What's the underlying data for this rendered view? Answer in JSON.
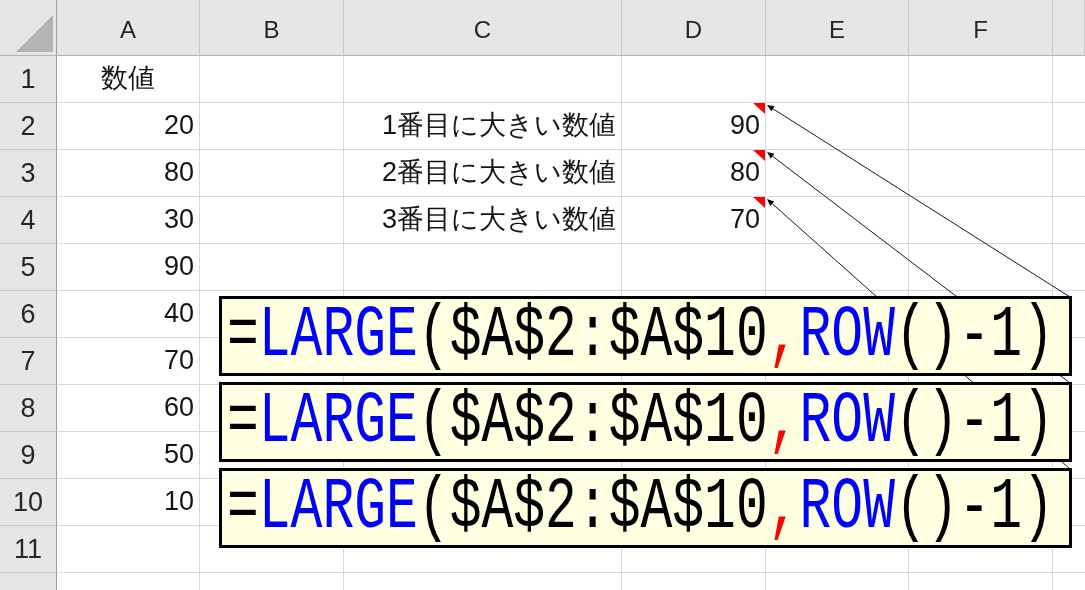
{
  "sheet": {
    "columns": [
      "A",
      "B",
      "C",
      "D",
      "E",
      "F"
    ],
    "rows": [
      {
        "number": "1",
        "a": "数値"
      },
      {
        "number": "2",
        "a": "20",
        "c": "1番目に大きい数値",
        "d": {
          "value": "90",
          "comment": [
            {
              "kind": "operator",
              "text": "="
            },
            {
              "kind": "function",
              "text": "LARGE"
            },
            {
              "kind": "plain",
              "text": "($A$2:$A$10"
            },
            {
              "kind": "separator",
              "text": ","
            },
            {
              "kind": "function",
              "text": "ROW"
            },
            {
              "kind": "plain",
              "text": "()-1)"
            }
          ]
        }
      },
      {
        "number": "3",
        "a": "80",
        "c": "2番目に大きい数値",
        "d": {
          "value": "80",
          "comment": [
            {
              "kind": "operator",
              "text": "="
            },
            {
              "kind": "function",
              "text": "LARGE"
            },
            {
              "kind": "plain",
              "text": "($A$2:$A$10"
            },
            {
              "kind": "separator",
              "text": ","
            },
            {
              "kind": "function",
              "text": "ROW"
            },
            {
              "kind": "plain",
              "text": "()-1)"
            }
          ]
        }
      },
      {
        "number": "4",
        "a": "30",
        "c": "3番目に大きい数値",
        "d": {
          "value": "70",
          "comment": [
            {
              "kind": "operator",
              "text": "="
            },
            {
              "kind": "function",
              "text": "LARGE"
            },
            {
              "kind": "plain",
              "text": "($A$2:$A$10"
            },
            {
              "kind": "separator",
              "text": ","
            },
            {
              "kind": "function",
              "text": "ROW"
            },
            {
              "kind": "plain",
              "text": "()-1)"
            }
          ]
        }
      },
      {
        "number": "5",
        "a": "90"
      },
      {
        "number": "6",
        "a": "40"
      },
      {
        "number": "7",
        "a": "70"
      },
      {
        "number": "8",
        "a": "60"
      },
      {
        "number": "9",
        "a": "50"
      },
      {
        "number": "10",
        "a": "10"
      },
      {
        "number": "11"
      }
    ]
  }
}
